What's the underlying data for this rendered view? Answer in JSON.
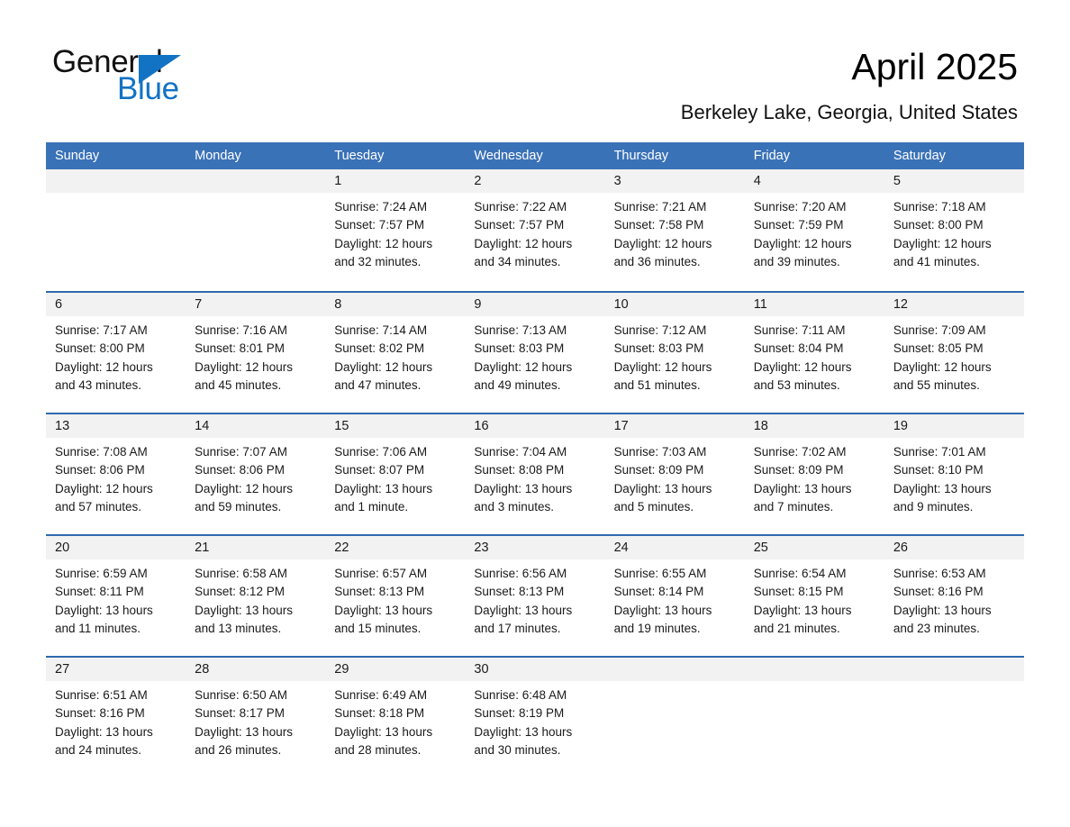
{
  "brand": {
    "word_one": "General",
    "word_two": "Blue",
    "triangle_icon": "triangle-logo-icon",
    "accent_color": "#1273c4"
  },
  "header": {
    "title": "April 2025",
    "subtitle": "Berkeley Lake, Georgia, United States",
    "header_bg_color": "#3a72b8",
    "daynum_strip_color": "#f2f2f2"
  },
  "calendar": {
    "weekday_headers": [
      "Sunday",
      "Monday",
      "Tuesday",
      "Wednesday",
      "Thursday",
      "Friday",
      "Saturday"
    ],
    "weeks": [
      [
        {
          "day": "",
          "sunrise": "",
          "sunset": "",
          "daylight_line1": "",
          "daylight_line2": "",
          "empty": true
        },
        {
          "day": "",
          "sunrise": "",
          "sunset": "",
          "daylight_line1": "",
          "daylight_line2": "",
          "empty": true
        },
        {
          "day": "1",
          "sunrise": "Sunrise: 7:24 AM",
          "sunset": "Sunset: 7:57 PM",
          "daylight_line1": "Daylight: 12 hours",
          "daylight_line2": "and 32 minutes.",
          "empty": false
        },
        {
          "day": "2",
          "sunrise": "Sunrise: 7:22 AM",
          "sunset": "Sunset: 7:57 PM",
          "daylight_line1": "Daylight: 12 hours",
          "daylight_line2": "and 34 minutes.",
          "empty": false
        },
        {
          "day": "3",
          "sunrise": "Sunrise: 7:21 AM",
          "sunset": "Sunset: 7:58 PM",
          "daylight_line1": "Daylight: 12 hours",
          "daylight_line2": "and 36 minutes.",
          "empty": false
        },
        {
          "day": "4",
          "sunrise": "Sunrise: 7:20 AM",
          "sunset": "Sunset: 7:59 PM",
          "daylight_line1": "Daylight: 12 hours",
          "daylight_line2": "and 39 minutes.",
          "empty": false
        },
        {
          "day": "5",
          "sunrise": "Sunrise: 7:18 AM",
          "sunset": "Sunset: 8:00 PM",
          "daylight_line1": "Daylight: 12 hours",
          "daylight_line2": "and 41 minutes.",
          "empty": false
        }
      ],
      [
        {
          "day": "6",
          "sunrise": "Sunrise: 7:17 AM",
          "sunset": "Sunset: 8:00 PM",
          "daylight_line1": "Daylight: 12 hours",
          "daylight_line2": "and 43 minutes.",
          "empty": false
        },
        {
          "day": "7",
          "sunrise": "Sunrise: 7:16 AM",
          "sunset": "Sunset: 8:01 PM",
          "daylight_line1": "Daylight: 12 hours",
          "daylight_line2": "and 45 minutes.",
          "empty": false
        },
        {
          "day": "8",
          "sunrise": "Sunrise: 7:14 AM",
          "sunset": "Sunset: 8:02 PM",
          "daylight_line1": "Daylight: 12 hours",
          "daylight_line2": "and 47 minutes.",
          "empty": false
        },
        {
          "day": "9",
          "sunrise": "Sunrise: 7:13 AM",
          "sunset": "Sunset: 8:03 PM",
          "daylight_line1": "Daylight: 12 hours",
          "daylight_line2": "and 49 minutes.",
          "empty": false
        },
        {
          "day": "10",
          "sunrise": "Sunrise: 7:12 AM",
          "sunset": "Sunset: 8:03 PM",
          "daylight_line1": "Daylight: 12 hours",
          "daylight_line2": "and 51 minutes.",
          "empty": false
        },
        {
          "day": "11",
          "sunrise": "Sunrise: 7:11 AM",
          "sunset": "Sunset: 8:04 PM",
          "daylight_line1": "Daylight: 12 hours",
          "daylight_line2": "and 53 minutes.",
          "empty": false
        },
        {
          "day": "12",
          "sunrise": "Sunrise: 7:09 AM",
          "sunset": "Sunset: 8:05 PM",
          "daylight_line1": "Daylight: 12 hours",
          "daylight_line2": "and 55 minutes.",
          "empty": false
        }
      ],
      [
        {
          "day": "13",
          "sunrise": "Sunrise: 7:08 AM",
          "sunset": "Sunset: 8:06 PM",
          "daylight_line1": "Daylight: 12 hours",
          "daylight_line2": "and 57 minutes.",
          "empty": false
        },
        {
          "day": "14",
          "sunrise": "Sunrise: 7:07 AM",
          "sunset": "Sunset: 8:06 PM",
          "daylight_line1": "Daylight: 12 hours",
          "daylight_line2": "and 59 minutes.",
          "empty": false
        },
        {
          "day": "15",
          "sunrise": "Sunrise: 7:06 AM",
          "sunset": "Sunset: 8:07 PM",
          "daylight_line1": "Daylight: 13 hours",
          "daylight_line2": "and 1 minute.",
          "empty": false
        },
        {
          "day": "16",
          "sunrise": "Sunrise: 7:04 AM",
          "sunset": "Sunset: 8:08 PM",
          "daylight_line1": "Daylight: 13 hours",
          "daylight_line2": "and 3 minutes.",
          "empty": false
        },
        {
          "day": "17",
          "sunrise": "Sunrise: 7:03 AM",
          "sunset": "Sunset: 8:09 PM",
          "daylight_line1": "Daylight: 13 hours",
          "daylight_line2": "and 5 minutes.",
          "empty": false
        },
        {
          "day": "18",
          "sunrise": "Sunrise: 7:02 AM",
          "sunset": "Sunset: 8:09 PM",
          "daylight_line1": "Daylight: 13 hours",
          "daylight_line2": "and 7 minutes.",
          "empty": false
        },
        {
          "day": "19",
          "sunrise": "Sunrise: 7:01 AM",
          "sunset": "Sunset: 8:10 PM",
          "daylight_line1": "Daylight: 13 hours",
          "daylight_line2": "and 9 minutes.",
          "empty": false
        }
      ],
      [
        {
          "day": "20",
          "sunrise": "Sunrise: 6:59 AM",
          "sunset": "Sunset: 8:11 PM",
          "daylight_line1": "Daylight: 13 hours",
          "daylight_line2": "and 11 minutes.",
          "empty": false
        },
        {
          "day": "21",
          "sunrise": "Sunrise: 6:58 AM",
          "sunset": "Sunset: 8:12 PM",
          "daylight_line1": "Daylight: 13 hours",
          "daylight_line2": "and 13 minutes.",
          "empty": false
        },
        {
          "day": "22",
          "sunrise": "Sunrise: 6:57 AM",
          "sunset": "Sunset: 8:13 PM",
          "daylight_line1": "Daylight: 13 hours",
          "daylight_line2": "and 15 minutes.",
          "empty": false
        },
        {
          "day": "23",
          "sunrise": "Sunrise: 6:56 AM",
          "sunset": "Sunset: 8:13 PM",
          "daylight_line1": "Daylight: 13 hours",
          "daylight_line2": "and 17 minutes.",
          "empty": false
        },
        {
          "day": "24",
          "sunrise": "Sunrise: 6:55 AM",
          "sunset": "Sunset: 8:14 PM",
          "daylight_line1": "Daylight: 13 hours",
          "daylight_line2": "and 19 minutes.",
          "empty": false
        },
        {
          "day": "25",
          "sunrise": "Sunrise: 6:54 AM",
          "sunset": "Sunset: 8:15 PM",
          "daylight_line1": "Daylight: 13 hours",
          "daylight_line2": "and 21 minutes.",
          "empty": false
        },
        {
          "day": "26",
          "sunrise": "Sunrise: 6:53 AM",
          "sunset": "Sunset: 8:16 PM",
          "daylight_line1": "Daylight: 13 hours",
          "daylight_line2": "and 23 minutes.",
          "empty": false
        }
      ],
      [
        {
          "day": "27",
          "sunrise": "Sunrise: 6:51 AM",
          "sunset": "Sunset: 8:16 PM",
          "daylight_line1": "Daylight: 13 hours",
          "daylight_line2": "and 24 minutes.",
          "empty": false
        },
        {
          "day": "28",
          "sunrise": "Sunrise: 6:50 AM",
          "sunset": "Sunset: 8:17 PM",
          "daylight_line1": "Daylight: 13 hours",
          "daylight_line2": "and 26 minutes.",
          "empty": false
        },
        {
          "day": "29",
          "sunrise": "Sunrise: 6:49 AM",
          "sunset": "Sunset: 8:18 PM",
          "daylight_line1": "Daylight: 13 hours",
          "daylight_line2": "and 28 minutes.",
          "empty": false
        },
        {
          "day": "30",
          "sunrise": "Sunrise: 6:48 AM",
          "sunset": "Sunset: 8:19 PM",
          "daylight_line1": "Daylight: 13 hours",
          "daylight_line2": "and 30 minutes.",
          "empty": false
        },
        {
          "day": "",
          "sunrise": "",
          "sunset": "",
          "daylight_line1": "",
          "daylight_line2": "",
          "empty": true
        },
        {
          "day": "",
          "sunrise": "",
          "sunset": "",
          "daylight_line1": "",
          "daylight_line2": "",
          "empty": true
        },
        {
          "day": "",
          "sunrise": "",
          "sunset": "",
          "daylight_line1": "",
          "daylight_line2": "",
          "empty": true
        }
      ]
    ]
  }
}
